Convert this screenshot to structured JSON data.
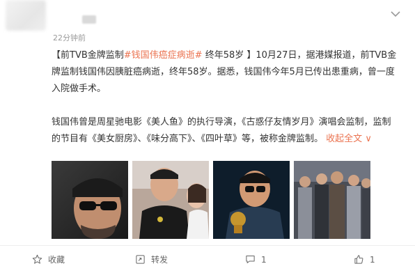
{
  "post": {
    "time": "22分钟前",
    "para1": {
      "prefix": "【前TVB金牌监制",
      "hashtag": "#钱国伟癌症病逝#",
      "rest": " 终年58岁 】10月27日，据港媒报道，前TVB金牌监制钱国伟因胰脏癌病逝，终年58岁。据悉，钱国伟今年5月已传出患重病，曾一度入院做手术。"
    },
    "para2": {
      "text": "钱国伟曾是周星驰电影《美人鱼》的执行导演，《古惑仔友情岁月》演唱会监制，监制的节目有《美女厨房》、《味分高下》、《四叶草》等，被称金牌监制。",
      "collapse_label": "收起全文",
      "collapse_glyph": "∨"
    },
    "photos": [
      {
        "name": "photo-portrait-glasses"
      },
      {
        "name": "photo-event-couple"
      },
      {
        "name": "photo-holding-trophy"
      },
      {
        "name": "photo-group-stage"
      }
    ]
  },
  "actions": {
    "favorite_label": "收藏",
    "repost_label": "转发",
    "comment_count": "1",
    "like_count": "1"
  },
  "colors": {
    "accent": "#eb7350",
    "text": "#333333",
    "muted": "#9a9a9a"
  },
  "icons": {
    "favorite": "star-icon",
    "repost": "repost-icon",
    "comment": "comment-icon",
    "like": "thumbs-up-icon",
    "menu": "chevron-down-icon"
  }
}
